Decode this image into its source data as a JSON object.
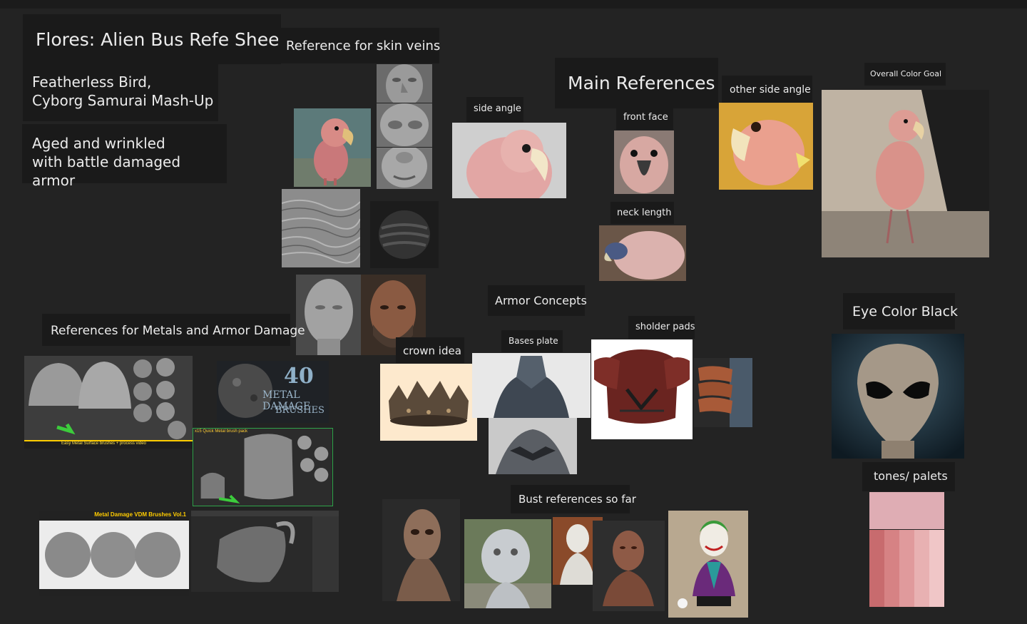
{
  "board": {
    "title": "Flores: Alien Bus Refe Sheet",
    "subtitle1": "Featherless Bird,\nCyborg Samurai Mash-Up",
    "subtitle2": "Aged and wrinkled\nwith battle damaged armor"
  },
  "labels": {
    "skin_veins": "Reference for skin veins",
    "main_refs": "Main References",
    "side_angle": "side angle",
    "front_face": "front face",
    "other_side": "other side angle",
    "color_goal": "Overall Color Goal",
    "neck_length": "neck length",
    "metals": "References for Metals and Armor Damage",
    "armor_concepts": "Armor Concepts",
    "crown_idea": "crown idea",
    "bases_plate": "Bases plate",
    "sholder_pads": "sholder pads",
    "eye_color": "Eye Color Black",
    "tones": "tones/ palets",
    "bust_refs": "Bust references so far"
  },
  "image_text": {
    "metal_count": "40",
    "metal_line1": "METAL DAMAGE",
    "metal_line2": "BRUSHES",
    "vdm_title": "Metal Damage VDM Brushes Vol.1",
    "helmet_caption": "Easy Metal Surface brushes + process video",
    "quick_pack": "x15 Quick Metal brush pack"
  },
  "palette": {
    "top": "#dfadb4",
    "stripes": [
      "#c86b6e",
      "#d68284",
      "#e09a9c",
      "#e8b1b2",
      "#f0c6c7"
    ]
  }
}
